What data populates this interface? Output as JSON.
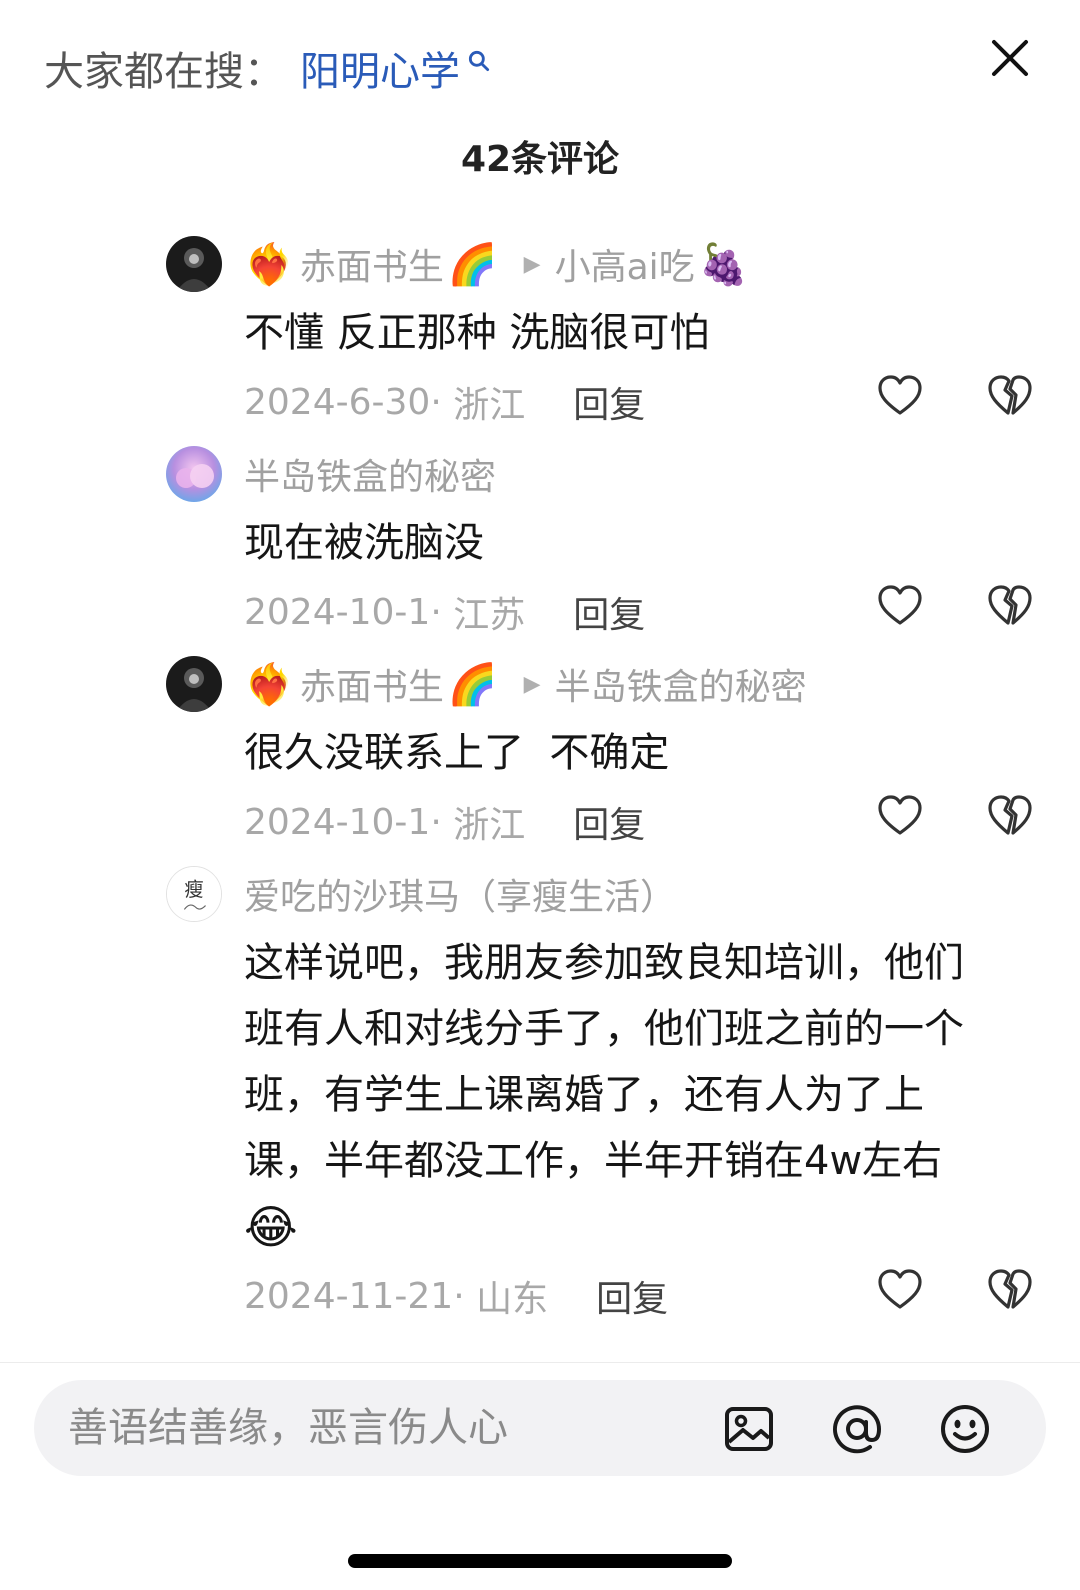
{
  "header": {
    "search_prefix": "大家都在搜：",
    "search_keyword": "阳明心学",
    "comment_count": "42条评论"
  },
  "comments": [
    {
      "author_emoji": "❤️‍🔥",
      "author": "赤面书生",
      "author_badge": "🌈",
      "reply_to": "小高ai吃",
      "reply_to_emoji": "🍇",
      "text": "不懂 反正那种 洗脑很可怕",
      "date": "2024-6-30",
      "location": "浙江",
      "reply_label": "回复"
    },
    {
      "author": "半岛铁盒的秘密",
      "text": "现在被洗脑没",
      "date": "2024-10-1",
      "location": "江苏",
      "reply_label": "回复"
    },
    {
      "author_emoji": "❤️‍🔥",
      "author": "赤面书生",
      "author_badge": "🌈",
      "reply_to": "半岛铁盒的秘密",
      "text": "很久没联系上了  不确定",
      "date": "2024-10-1",
      "location": "浙江",
      "reply_label": "回复"
    },
    {
      "author": "爱吃的沙琪马（享瘦生活）",
      "avatar_text": "瘦",
      "text_lines": [
        "这样说吧，我朋友参加致良知培训，他们",
        "班有人和对线分手了，他们班之前的一个",
        "班，有学生上课离婚了，还有人为了上",
        "课，半年都没工作，半年开销在4w左右"
      ],
      "text_emoji": "😂",
      "date": "2024-11-21",
      "location": "山东",
      "reply_label": "回复"
    }
  ],
  "input": {
    "placeholder": "善语结善缘，恶言伤人心"
  },
  "icons": {
    "close": "close-icon",
    "search": "search-icon",
    "like": "heart-icon",
    "dislike": "broken-heart-icon",
    "image": "image-icon",
    "mention": "at-icon",
    "emoji": "emoji-icon"
  },
  "colors": {
    "keyword": "#2a5bb8",
    "muted": "#a0a0a0",
    "input_bg": "#f2f2f4"
  }
}
